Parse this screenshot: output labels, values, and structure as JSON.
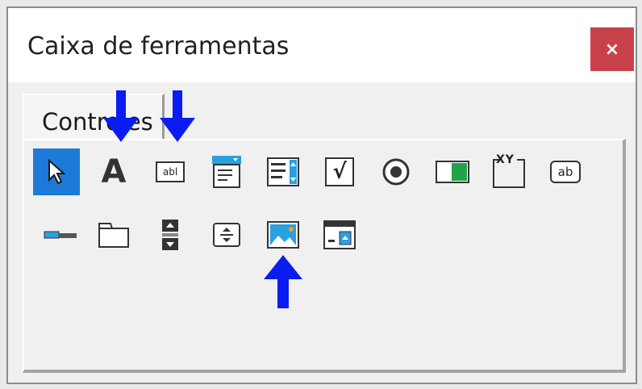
{
  "window": {
    "title": "Caixa de ferramentas",
    "close_label": "×"
  },
  "tabs": [
    {
      "label": "Controles",
      "active": true
    }
  ],
  "colors": {
    "selected": "#1e7ad8",
    "close": "#c9424a",
    "arrow": "#0a1cf0",
    "icon_blue": "#2aa0e0"
  },
  "tools": [
    {
      "name": "pointer-icon",
      "selected": true
    },
    {
      "name": "label-icon",
      "glyph": "A"
    },
    {
      "name": "textbox-icon",
      "glyph": "abl"
    },
    {
      "name": "combobox-icon"
    },
    {
      "name": "listbox-icon"
    },
    {
      "name": "checkbox-icon",
      "glyph": "√"
    },
    {
      "name": "option-button-icon"
    },
    {
      "name": "toggle-button-icon"
    },
    {
      "name": "frame-icon",
      "glyph": "XY"
    },
    {
      "name": "command-button-icon",
      "glyph": "ab"
    },
    {
      "name": "tabstrip-icon"
    },
    {
      "name": "multipage-icon"
    },
    {
      "name": "scrollbar-icon"
    },
    {
      "name": "spinbutton-icon"
    },
    {
      "name": "image-icon"
    },
    {
      "name": "refedit-icon"
    }
  ],
  "markers": [
    {
      "name": "arrow-down-icon",
      "points_to": "label-icon"
    },
    {
      "name": "arrow-down-icon",
      "points_to": "textbox-icon"
    },
    {
      "name": "arrow-up-icon",
      "points_to": "image-icon"
    }
  ]
}
